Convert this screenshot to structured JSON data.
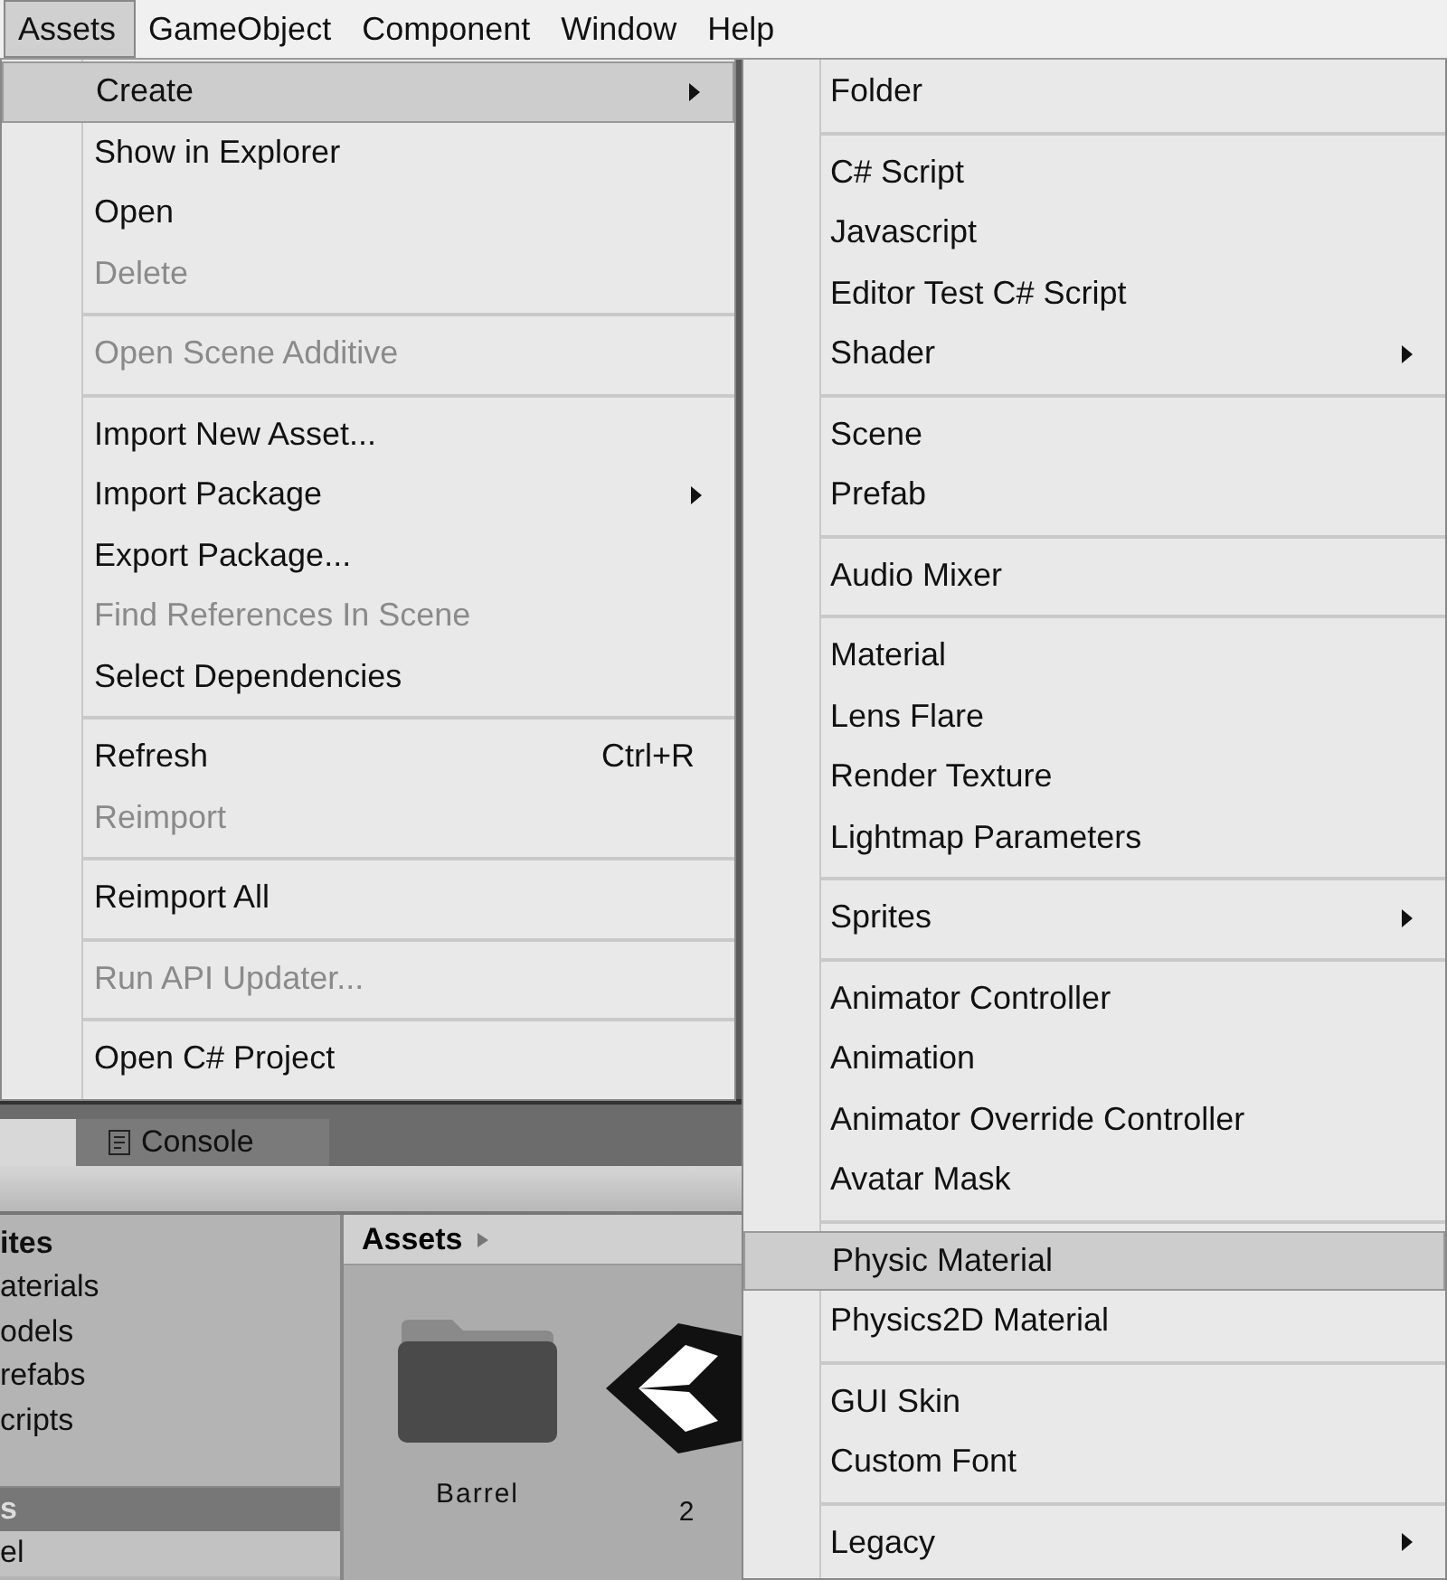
{
  "menu_bar": [
    {
      "label": "Assets",
      "selected": true
    },
    {
      "label": "GameObject",
      "selected": false
    },
    {
      "label": "Component",
      "selected": false
    },
    {
      "label": "Window",
      "selected": false
    },
    {
      "label": "Help",
      "selected": false
    }
  ],
  "assets_menu": {
    "groups": [
      {
        "items": [
          {
            "label": "Create",
            "selected": true,
            "disabled": false,
            "submenu": true
          },
          {
            "label": "Show in Explorer",
            "selected": false,
            "disabled": false,
            "submenu": false
          },
          {
            "label": "Open",
            "selected": false,
            "disabled": false,
            "submenu": false
          },
          {
            "label": "Delete",
            "selected": false,
            "disabled": true,
            "submenu": false
          }
        ]
      },
      {
        "items": [
          {
            "label": "Open Scene Additive",
            "selected": false,
            "disabled": true,
            "submenu": false
          }
        ]
      },
      {
        "items": [
          {
            "label": "Import New Asset...",
            "selected": false,
            "disabled": false,
            "submenu": false
          },
          {
            "label": "Import Package",
            "selected": false,
            "disabled": false,
            "submenu": true
          },
          {
            "label": "Export Package...",
            "selected": false,
            "disabled": false,
            "submenu": false
          },
          {
            "label": "Find References In Scene",
            "selected": false,
            "disabled": true,
            "submenu": false
          },
          {
            "label": "Select Dependencies",
            "selected": false,
            "disabled": false,
            "submenu": false
          }
        ]
      },
      {
        "items": [
          {
            "label": "Refresh",
            "shortcut": "Ctrl+R",
            "selected": false,
            "disabled": false,
            "submenu": false
          },
          {
            "label": "Reimport",
            "selected": false,
            "disabled": true,
            "submenu": false
          }
        ]
      },
      {
        "items": [
          {
            "label": "Reimport All",
            "selected": false,
            "disabled": false,
            "submenu": false
          }
        ]
      },
      {
        "items": [
          {
            "label": "Run API Updater...",
            "selected": false,
            "disabled": true,
            "submenu": false
          }
        ]
      },
      {
        "items": [
          {
            "label": "Open C# Project",
            "selected": false,
            "disabled": false,
            "submenu": false
          }
        ]
      }
    ]
  },
  "create_submenu": {
    "groups": [
      {
        "items": [
          {
            "label": "Folder",
            "selected": false,
            "disabled": false,
            "submenu": false
          }
        ]
      },
      {
        "items": [
          {
            "label": "C# Script",
            "selected": false,
            "disabled": false,
            "submenu": false
          },
          {
            "label": "Javascript",
            "selected": false,
            "disabled": false,
            "submenu": false
          },
          {
            "label": "Editor Test C# Script",
            "selected": false,
            "disabled": false,
            "submenu": false
          },
          {
            "label": "Shader",
            "selected": false,
            "disabled": false,
            "submenu": true
          }
        ]
      },
      {
        "items": [
          {
            "label": "Scene",
            "selected": false,
            "disabled": false,
            "submenu": false
          },
          {
            "label": "Prefab",
            "selected": false,
            "disabled": false,
            "submenu": false
          }
        ]
      },
      {
        "items": [
          {
            "label": "Audio Mixer",
            "selected": false,
            "disabled": false,
            "submenu": false
          }
        ]
      },
      {
        "items": [
          {
            "label": "Material",
            "selected": false,
            "disabled": false,
            "submenu": false
          },
          {
            "label": "Lens Flare",
            "selected": false,
            "disabled": false,
            "submenu": false
          },
          {
            "label": "Render Texture",
            "selected": false,
            "disabled": false,
            "submenu": false
          },
          {
            "label": "Lightmap Parameters",
            "selected": false,
            "disabled": false,
            "submenu": false
          }
        ]
      },
      {
        "items": [
          {
            "label": "Sprites",
            "selected": false,
            "disabled": false,
            "submenu": true
          }
        ]
      },
      {
        "items": [
          {
            "label": "Animator Controller",
            "selected": false,
            "disabled": false,
            "submenu": false
          },
          {
            "label": "Animation",
            "selected": false,
            "disabled": false,
            "submenu": false
          },
          {
            "label": "Animator Override Controller",
            "selected": false,
            "disabled": false,
            "submenu": false
          },
          {
            "label": "Avatar Mask",
            "selected": false,
            "disabled": false,
            "submenu": false
          }
        ]
      },
      {
        "items": [
          {
            "label": "Physic Material",
            "selected": true,
            "disabled": false,
            "submenu": false
          },
          {
            "label": "Physics2D Material",
            "selected": false,
            "disabled": false,
            "submenu": false
          }
        ]
      },
      {
        "items": [
          {
            "label": "GUI Skin",
            "selected": false,
            "disabled": false,
            "submenu": false
          },
          {
            "label": "Custom Font",
            "selected": false,
            "disabled": false,
            "submenu": false
          }
        ]
      },
      {
        "items": [
          {
            "label": "Legacy",
            "selected": false,
            "disabled": false,
            "submenu": true
          }
        ]
      }
    ]
  },
  "editor": {
    "tabs": [
      {
        "selected": true
      },
      {
        "label": "Console",
        "selected": false
      }
    ],
    "favorites": {
      "header": "ites",
      "items": [
        {
          "label": "aterials",
          "selected": false
        },
        {
          "label": "odels",
          "selected": false
        },
        {
          "label": "refabs",
          "selected": false
        },
        {
          "label": "cripts",
          "selected": false
        }
      ]
    },
    "assets_section": {
      "header": "s",
      "selected": true,
      "items": [
        {
          "label": "el",
          "selected": true
        }
      ]
    },
    "breadcrumb": "Assets",
    "assets": [
      {
        "name": "Barrel",
        "kind": "folder"
      },
      {
        "name": "2",
        "kind": "unity"
      }
    ]
  }
}
